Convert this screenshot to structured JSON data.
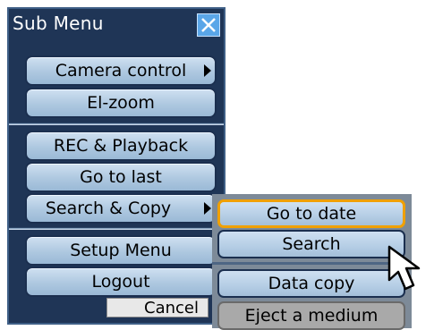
{
  "window": {
    "title": "Sub Menu",
    "close_icon": "close-icon"
  },
  "menu": {
    "items": [
      {
        "label": "Camera control",
        "has_submenu": true
      },
      {
        "label": "El-zoom",
        "has_submenu": false
      },
      {
        "label": "REC & Playback",
        "has_submenu": false
      },
      {
        "label": "Go to last",
        "has_submenu": false
      },
      {
        "label": "Search & Copy",
        "has_submenu": true
      },
      {
        "label": "Setup Menu",
        "has_submenu": false
      },
      {
        "label": "Logout",
        "has_submenu": false
      }
    ],
    "cancel_label": "Cancel"
  },
  "submenu": {
    "items": [
      {
        "label": "Go to date",
        "state": "focused"
      },
      {
        "label": "Search",
        "state": "normal"
      },
      {
        "label": "Data copy",
        "state": "normal"
      },
      {
        "label": "Eject a medium",
        "state": "disabled"
      }
    ]
  },
  "colors": {
    "panel_bg": "#1f3556",
    "button_bg": "#b7cfe6",
    "focus_outline": "#f0a000",
    "close_bg": "#5aa6e8"
  },
  "pointer": {
    "icon": "mouse-pointer-icon"
  }
}
